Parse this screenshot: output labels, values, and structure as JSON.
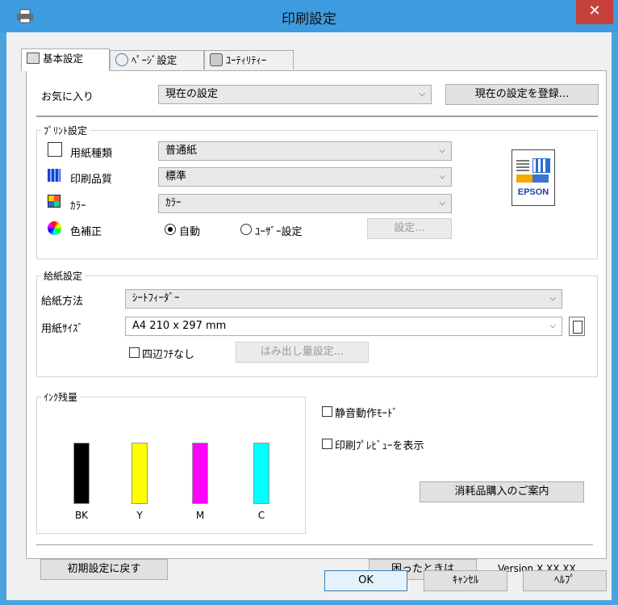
{
  "window": {
    "title": "印刷設定",
    "close_glyph": "✕"
  },
  "tabs": [
    {
      "label": "基本設定",
      "active": true,
      "icon": "printer-settings-icon"
    },
    {
      "label": "ﾍﾟｰｼﾞ設定",
      "active": false,
      "icon": "page-layout-icon"
    },
    {
      "label": "ﾕｰﾃｨﾘﾃｨｰ",
      "active": false,
      "icon": "utility-icon"
    }
  ],
  "favorites": {
    "label": "お気に入り",
    "value": "現在の設定",
    "register_button": "現在の設定を登録..."
  },
  "print_settings": {
    "group_title": "ﾌﾟﾘﾝﾄ設定",
    "paper_type": {
      "label": "用紙種類",
      "value": "普通紙"
    },
    "quality": {
      "label": "印刷品質",
      "value": "標準"
    },
    "color": {
      "label": "ｶﾗｰ",
      "value": "ｶﾗｰ"
    },
    "correction": {
      "label": "色補正",
      "auto_label": "自動",
      "user_label": "ﾕｰｻﾞｰ設定",
      "selected": "auto",
      "settings_button": "設定..."
    },
    "brand": "EPSON"
  },
  "paper_feed": {
    "group_title": "給紙設定",
    "source": {
      "label": "給紙方法",
      "value": "ｼｰﾄﾌｨｰﾀﾞｰ"
    },
    "size": {
      "label": "用紙ｻｲｽﾞ",
      "value": "A4 210 x 297 mm"
    },
    "borderless": {
      "label": "四辺ﾌﾁなし",
      "checked": false
    },
    "overflow_button": "はみ出し量設定..."
  },
  "ink": {
    "group_title": "ｲﾝｸ残量",
    "cartridges": [
      {
        "label": "BK",
        "color": "#000000"
      },
      {
        "label": "Y",
        "color": "#ffff00"
      },
      {
        "label": "M",
        "color": "#ff00ff"
      },
      {
        "label": "C",
        "color": "#00ffff"
      }
    ]
  },
  "options": {
    "quiet_mode": {
      "label": "静音動作ﾓｰﾄﾞ",
      "checked": false
    },
    "preview": {
      "label": "印刷ﾌﾟﾚﾋﾞｭｰを表示",
      "checked": false
    },
    "supplies_button": "消耗品購入のご案内"
  },
  "footer": {
    "reset_button": "初期設定に戻す",
    "help_button": "困ったときは",
    "version": "Version X.XX.XX"
  },
  "dialog_buttons": {
    "ok": "OK",
    "cancel": "ｷｬﾝｾﾙ",
    "help": "ﾍﾙﾌﾟ"
  },
  "colors": {
    "titlebar": "#3d9be0",
    "close": "#c7413c",
    "accent_border": "#3c7fb1"
  }
}
